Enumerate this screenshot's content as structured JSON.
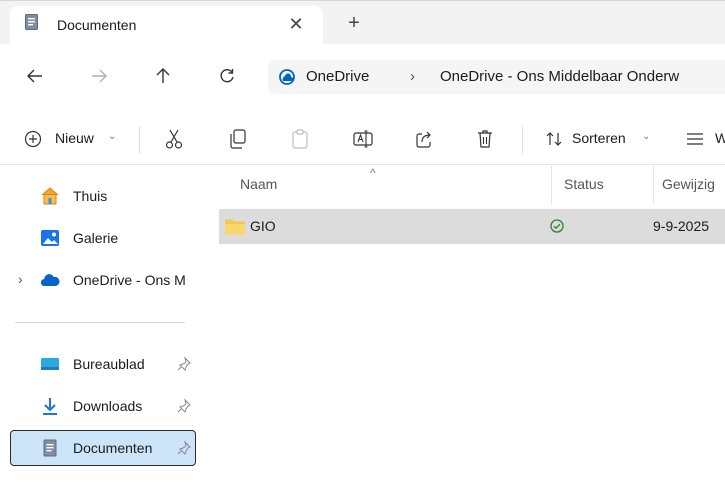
{
  "tab": {
    "title": "Documenten",
    "close_symbol": "✕",
    "new_tab_symbol": "+"
  },
  "address": {
    "crumbs": [
      "OneDrive",
      "OneDrive - Ons Middelbaar Onderw"
    ],
    "separator": "›"
  },
  "commands": {
    "new_label": "Nieuw",
    "sort_label": "Sorteren",
    "view_label": "W",
    "chevron": "⌄"
  },
  "sidebar": {
    "items": [
      {
        "label": "Thuis",
        "icon": "home-icon"
      },
      {
        "label": "Galerie",
        "icon": "gallery-icon"
      },
      {
        "label": "OneDrive - Ons M",
        "icon": "onedrive-cloud-icon"
      },
      {
        "label": "Bureaublad",
        "icon": "desktop-folder-icon"
      },
      {
        "label": "Downloads",
        "icon": "download-icon"
      },
      {
        "label": "Documenten",
        "icon": "documents-icon"
      }
    ],
    "expand_symbol": "›"
  },
  "columns": {
    "name": "Naam",
    "status": "Status",
    "modified": "Gewijzig",
    "sort_symbol": "^"
  },
  "rows": [
    {
      "name": "GIO",
      "date": "9-9-2025",
      "status_icon": "synced-check-icon"
    }
  ],
  "colors": {
    "accent": "#0067c0",
    "folder": "#f2c94c",
    "selected_bg": "#cce4f7",
    "row_hover": "#dcdcdc",
    "status_ok": "#2e7d32"
  }
}
